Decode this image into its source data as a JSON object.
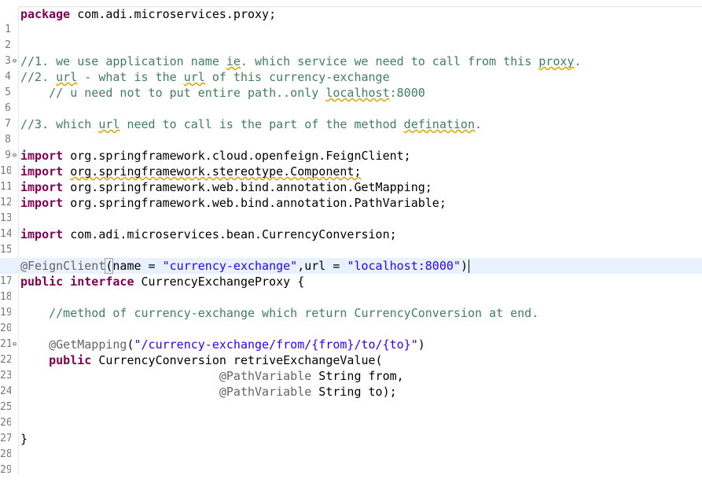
{
  "editor": {
    "lines": [
      {
        "num": "1",
        "text": "package com.adi.microservices.proxy;"
      },
      {
        "num": "2",
        "text": ""
      },
      {
        "num": "3",
        "text": ""
      },
      {
        "num": "4",
        "text": "//1. we use application name ie. which service we need to call from this proxy."
      },
      {
        "num": "5",
        "text": "//2. url - what is the url of this currency-exchange"
      },
      {
        "num": "6",
        "text": "    // u need not to put entire path..only localhost:8000"
      },
      {
        "num": "7",
        "text": ""
      },
      {
        "num": "8",
        "text": "//3. which url need to call is the part of the method defination."
      },
      {
        "num": "9",
        "text": ""
      },
      {
        "num": "10",
        "text": "import org.springframework.cloud.openfeign.FeignClient;"
      },
      {
        "num": "11",
        "text": "import org.springframework.stereotype.Component;"
      },
      {
        "num": "12",
        "text": "import org.springframework.web.bind.annotation.GetMapping;"
      },
      {
        "num": "13",
        "text": "import org.springframework.web.bind.annotation.PathVariable;"
      },
      {
        "num": "14",
        "text": ""
      },
      {
        "num": "15",
        "text": "import com.adi.microservices.bean.CurrencyConversion;"
      },
      {
        "num": "16",
        "text": ""
      },
      {
        "num": "17",
        "text": "@FeignClient(name = \"currency-exchange\",url = \"localhost:8000\")"
      },
      {
        "num": "18",
        "text": "public interface CurrencyExchangeProxy {"
      },
      {
        "num": "19",
        "text": ""
      },
      {
        "num": "20",
        "text": "    //method of currency-exchange which return CurrencyConversion at end."
      },
      {
        "num": "21",
        "text": ""
      },
      {
        "num": "22",
        "text": "    @GetMapping(\"/currency-exchange/from/{from}/to/{to}\")"
      },
      {
        "num": "23",
        "text": "    public CurrencyConversion retriveExchangeValue("
      },
      {
        "num": "24",
        "text": "                            @PathVariable String from,"
      },
      {
        "num": "25",
        "text": "                            @PathVariable String to);"
      },
      {
        "num": "26",
        "text": ""
      },
      {
        "num": "27",
        "text": ""
      },
      {
        "num": "28",
        "text": "}"
      },
      {
        "num": "29",
        "text": ""
      }
    ],
    "tokens": {
      "kw_package": "package",
      "pkg_name": "com.adi.microservices.proxy;",
      "c4_a": "//1. we use application name ",
      "c4_ie": "ie",
      "c4_b": ". which service we need to call from this ",
      "c4_proxy": "proxy",
      "c4_c": ".",
      "c5_a": "//2. ",
      "c5_url1": "url",
      "c5_b": " - what is the ",
      "c5_url2": "url",
      "c5_c": " of this currency-exchange",
      "c6_a": "    // u need not to put entire path..only ",
      "c6_localhost": "localhost",
      "c6_b": ":8000",
      "c8_a": "//3. which ",
      "c8_url": "url",
      "c8_b": " need to call is the part of the method ",
      "c8_defination": "defination",
      "c8_c": ".",
      "kw_import": "import",
      "imp_10": "org.springframework.cloud.openfeign.FeignClient;",
      "imp_11": "org.springframework.stereotype.Component;",
      "imp_12": "org.springframework.web.bind.annotation.GetMapping;",
      "imp_13": "org.springframework.web.bind.annotation.PathVariable;",
      "imp_15": "com.adi.microservices.bean.CurrencyConversion;",
      "ann_feign": "@FeignClient",
      "paren_open": "(",
      "l17_name": "name = ",
      "str_exchange": "\"currency-exchange\"",
      "l17_url": ",url = ",
      "str_localhost": "\"localhost:8000\"",
      "paren_close": ")",
      "kw_public": "public",
      "kw_interface": "interface",
      "l18_rest": " CurrencyExchangeProxy {",
      "c20": "//method of currency-exchange which return CurrencyConversion at end.",
      "ann_get": "@GetMapping",
      "l22_open": "(",
      "str_path": "\"/currency-exchange/from/{from}/to/{to}\"",
      "l22_close": ")",
      "l23_rest": " CurrencyConversion retriveExchangeValue(",
      "ann_path": "@PathVariable",
      "l24_rest": " String from,",
      "l25_rest": " String to);",
      "l28": "}"
    }
  },
  "colors": {
    "keyword": "#7f0055",
    "comment": "#3f7f5f",
    "string": "#2a00ff",
    "annotation": "#646464",
    "current_line": "#e8f2fe",
    "line_number": "#787878"
  }
}
